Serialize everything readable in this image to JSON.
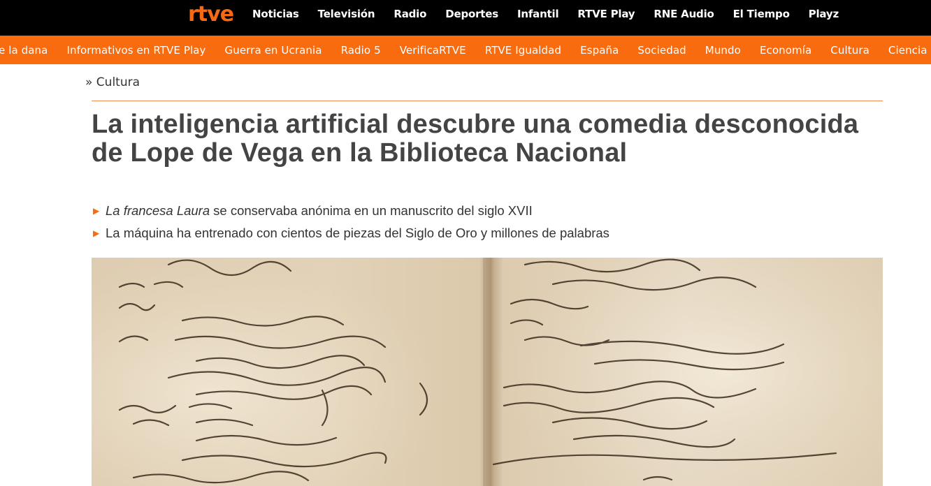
{
  "brand": {
    "logo_text": "rtve",
    "accent": "#f86b0f"
  },
  "main_nav": [
    "Noticias",
    "Televisión",
    "Radio",
    "Deportes",
    "Infantil",
    "RTVE Play",
    "RNE Audio",
    "El Tiempo",
    "Playz"
  ],
  "sub_nav": [
    "e la dana",
    "Informativos en RTVE Play",
    "Guerra en Ucrania",
    "Radio 5",
    "VerificaRTVE",
    "RTVE Igualdad",
    "España",
    "Sociedad",
    "Mundo",
    "Economía",
    "Cultura",
    "Ciencia"
  ],
  "breadcrumb": "» Cultura",
  "article": {
    "headline": "La inteligencia artificial descubre una comedia desconocida de Lope de Vega en la Biblioteca Nacional",
    "summary": [
      {
        "italic": "La francesa Laura",
        "text": "se conservaba anónima en un manuscrito del siglo XVII"
      },
      {
        "italic": "",
        "text": "La máquina ha entrenado con cientos de piezas del Siglo de Oro y millones de palabras"
      }
    ]
  }
}
